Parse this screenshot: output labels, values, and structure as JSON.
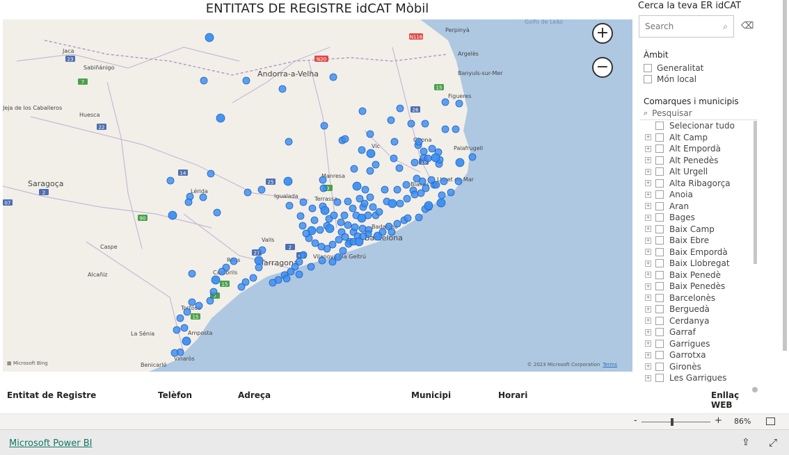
{
  "title": "ENTITATS DE REGISTRE idCAT Mòbil",
  "map": {
    "place_labels": [
      "Perpinyà",
      "Andorra-a-Velha",
      "Jaca",
      "Sabiñánigo",
      "Huesca",
      "Saragoça",
      "Lérida",
      "Igualada",
      "Terrassa",
      "Manresa",
      "Vic",
      "Figueres",
      "Girona",
      "Lloret de Mar",
      "Blanes",
      "Badalona",
      "Barcelona",
      "Valls",
      "Tarragona",
      "Reus",
      "Cambrils",
      "Vilanova i la Geltrú",
      "Caspe",
      "Alcañiz",
      "Tortosa",
      "Amposta",
      "La Sénia",
      "Benicarló",
      "Vinaròs",
      "Palafrugell",
      "Argelès",
      "Banyuls-sur-Mer",
      "Golfo de Leão",
      "Jeja de los Caballeros"
    ],
    "road_labels": [
      "N116",
      "N20",
      "23",
      "7",
      "22",
      "14",
      "2",
      "07",
      "90",
      "25",
      "9",
      "26",
      "15",
      "16",
      "2",
      "27",
      "42",
      "15",
      "7",
      "15"
    ],
    "zoom_in_glyph": "+",
    "zoom_out_glyph": "−",
    "attribution_logo": "Microsoft Bing",
    "copyright": "© 2023 Microsoft Corporation",
    "terms": "Terms",
    "marker_color": "#3b8ef0"
  },
  "search": {
    "title": "Cerca la teva ER idCAT",
    "placeholder": "Search",
    "icon": "search-icon",
    "clear_icon": "eraser-icon"
  },
  "ambit": {
    "title": "Àmbit",
    "options": [
      "Generalitat",
      "Món local"
    ]
  },
  "comarques": {
    "title": "Comarques i municipis",
    "search_placeholder": "Pesquisar",
    "select_all": "Selecionar tudo",
    "items": [
      "Alt Camp",
      "Alt Empordà",
      "Alt Penedès",
      "Alt Urgell",
      "Alta Ribagorça",
      "Anoia",
      "Aran",
      "Bages",
      "Baix Camp",
      "Baix Ebre",
      "Baix Empordà",
      "Baix Llobregat",
      "Baix Penedè",
      "Baix Penedès",
      "Barcelonès",
      "Berguedà",
      "Cerdanya",
      "Garraf",
      "Garrigues",
      "Garrotxa",
      "Gironès",
      "Les Garrigues"
    ]
  },
  "table": {
    "headers": [
      "Entitat de Registre",
      "Telèfon",
      "Adreça",
      "Municipi",
      "Horari",
      "Enllaç WEB"
    ]
  },
  "zoombar": {
    "minus": "-",
    "plus": "+",
    "percent": "86%",
    "zoom_fraction": 0.43
  },
  "footer": {
    "link": "Microsoft Power BI",
    "share_icon": "share-icon",
    "expand_icon": "expand-icon"
  }
}
